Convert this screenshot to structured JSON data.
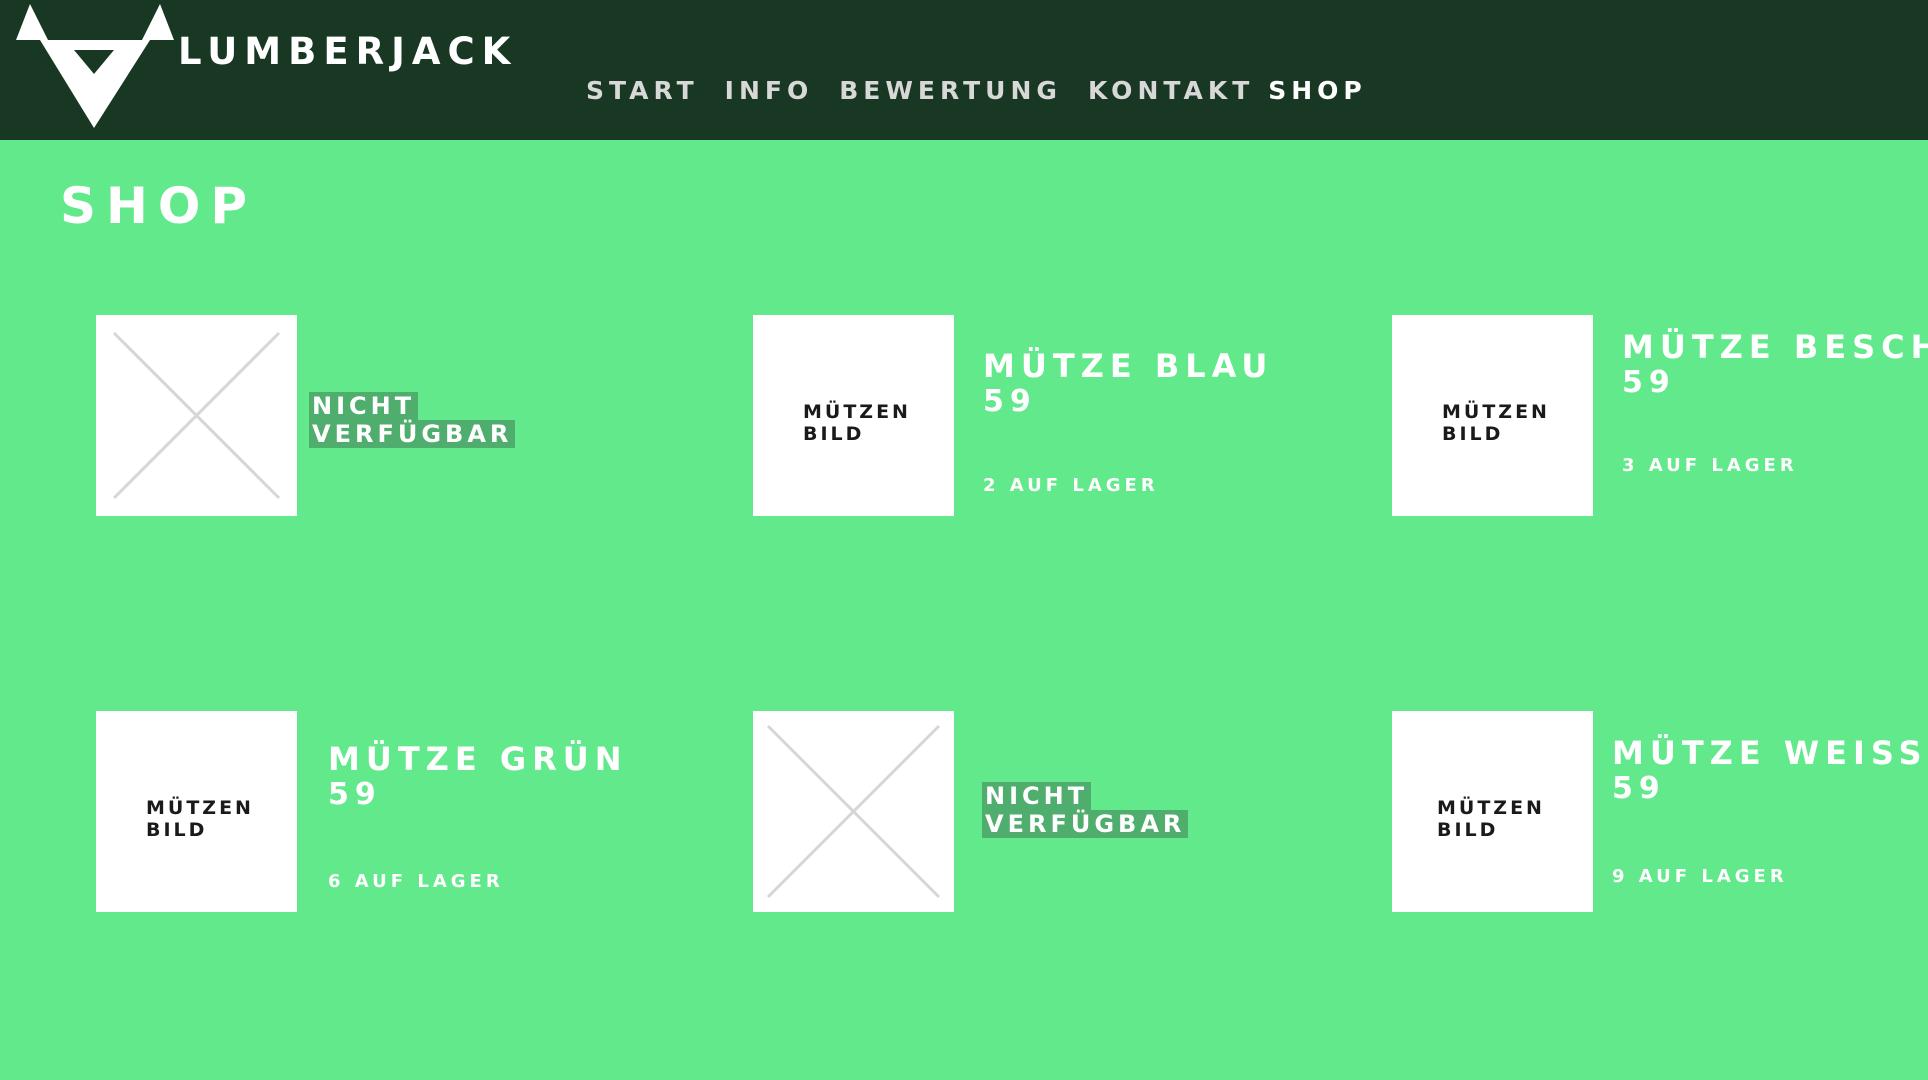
{
  "brand": "LUMBERJACK",
  "nav": [
    "START",
    "INFO",
    "BEWERTUNG",
    "KONTAKT",
    "SHOP"
  ],
  "page_title": "SHOP",
  "products": [
    {
      "image_line1": "",
      "image_line2": "",
      "unavailable_line1": "NICHT",
      "unavailable_line2": "VERFÜGBAR",
      "name": "",
      "price": "",
      "stock": ""
    },
    {
      "image_line1": "MÜTZEN",
      "image_line2": "BILD",
      "unavailable_line1": "",
      "unavailable_line2": "",
      "name": "MÜTZE BLAU",
      "price": "59",
      "stock": "2 AUF LAGER"
    },
    {
      "image_line1": "MÜTZEN",
      "image_line2": "BILD",
      "unavailable_line1": "",
      "unavailable_line2": "",
      "name": "MÜTZE BESCH",
      "price": "59",
      "stock": "3 AUF LAGER"
    },
    {
      "image_line1": "MÜTZEN",
      "image_line2": "BILD",
      "unavailable_line1": "",
      "unavailable_line2": "",
      "name": "MÜTZE GRÜN",
      "price": "59",
      "stock": "6 AUF LAGER"
    },
    {
      "image_line1": "",
      "image_line2": "",
      "unavailable_line1": "NICHT",
      "unavailable_line2": "VERFÜGBAR",
      "name": "",
      "price": "",
      "stock": ""
    },
    {
      "image_line1": "MÜTZEN",
      "image_line2": "BILD",
      "unavailable_line1": "",
      "unavailable_line2": "",
      "name": "MÜTZE WEISS",
      "price": "59",
      "stock": "9 AUF LAGER"
    }
  ],
  "icons": {
    "logo": "bull-head-logo-icon",
    "placeholder": "image-placeholder-icon"
  },
  "colors": {
    "background": "#62e98b",
    "header": "#193824",
    "text": "#ffffff",
    "highlight": "#4fae6e",
    "thumb": "#ffffff"
  }
}
